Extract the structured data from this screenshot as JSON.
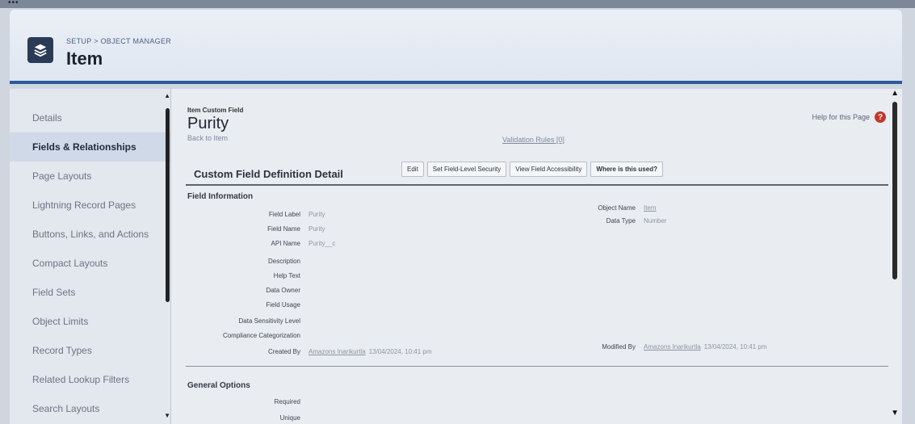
{
  "header": {
    "breadcrumb": "SETUP > OBJECT MANAGER",
    "object_title": "Item",
    "icon": "layers-icon"
  },
  "sidebar": {
    "items": [
      {
        "label": "Details",
        "active": false
      },
      {
        "label": "Fields & Relationships",
        "active": true
      },
      {
        "label": "Page Layouts",
        "active": false
      },
      {
        "label": "Lightning Record Pages",
        "active": false
      },
      {
        "label": "Buttons, Links, and Actions",
        "active": false
      },
      {
        "label": "Compact Layouts",
        "active": false
      },
      {
        "label": "Field Sets",
        "active": false
      },
      {
        "label": "Object Limits",
        "active": false
      },
      {
        "label": "Record Types",
        "active": false
      },
      {
        "label": "Related Lookup Filters",
        "active": false
      },
      {
        "label": "Search Layouts",
        "active": false
      }
    ]
  },
  "main": {
    "help_link": "Help for this Page",
    "page_label": "Item Custom Field",
    "page_title": "Purity",
    "back_link": "Back to Item",
    "validation_link": "Validation Rules [0]",
    "detail_header": "Custom Field Definition Detail",
    "buttons": {
      "edit": "Edit",
      "field_security": "Set Field-Level Security",
      "field_access": "View Field Accessibility",
      "where_used": "Where is this used?"
    },
    "field_info": {
      "title": "Field Information",
      "left": [
        {
          "label": "Field Label",
          "value": "Purity"
        },
        {
          "label": "Field Name",
          "value": "Purity"
        },
        {
          "label": "API Name",
          "value": "Purity__c"
        },
        {
          "label": "Description",
          "value": ""
        },
        {
          "label": "Help Text",
          "value": ""
        },
        {
          "label": "Data Owner",
          "value": ""
        },
        {
          "label": "Field Usage",
          "value": ""
        },
        {
          "label": "Data Sensitivity Level",
          "value": ""
        },
        {
          "label": "Compliance Categorization",
          "value": ""
        }
      ],
      "right": [
        {
          "label": "Object Name",
          "value": "Item"
        },
        {
          "label": "Data Type",
          "value": "Number"
        }
      ],
      "created_by": {
        "label": "Created By",
        "user": "Amazons Inarikurtla",
        "timestamp": "13/04/2024, 10:41 pm"
      },
      "modified_by": {
        "label": "Modified By",
        "user": "Amazons Inarikurtla",
        "timestamp": "13/04/2024, 10:41 pm"
      }
    },
    "general_options": {
      "title": "General Options",
      "rows": [
        {
          "label": "Required",
          "value": ""
        },
        {
          "label": "Unique",
          "value": ""
        }
      ]
    }
  },
  "colors": {
    "header_accent": "#2d5b9c",
    "help_icon": "#c0392b",
    "active_sidebar": "#cfd9e8"
  }
}
